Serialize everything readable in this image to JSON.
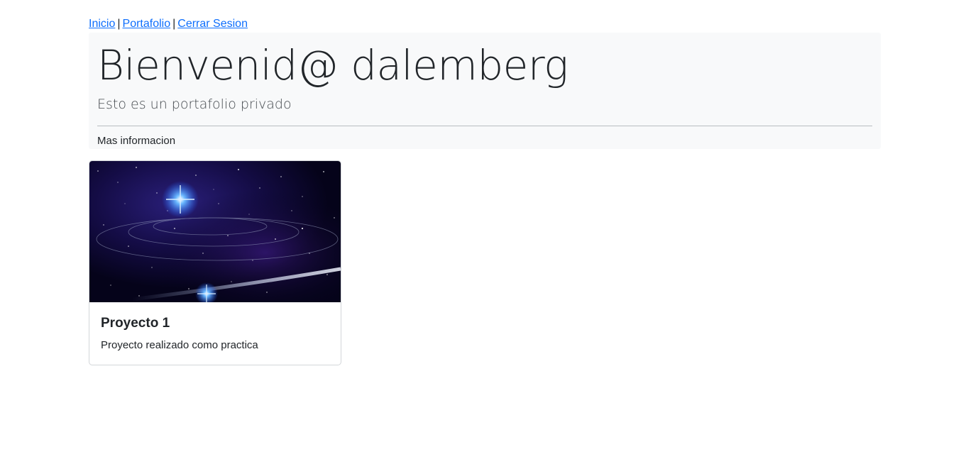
{
  "nav": {
    "links": [
      {
        "label": "Inicio"
      },
      {
        "label": "Portafolio"
      },
      {
        "label": "Cerrar Sesion"
      }
    ],
    "separator": "|"
  },
  "hero": {
    "title": "Bienvenid@ dalemberg",
    "subtitle": "Esto es un portafolio privado",
    "more_info": "Mas informacion"
  },
  "projects": [
    {
      "title": "Proyecto 1",
      "description": "Proyecto realizado como practica",
      "image": "galaxy-starfield-image"
    }
  ],
  "colors": {
    "link": "#0d6efd",
    "hero_bg": "#f8f9fa",
    "text": "#212529",
    "card_border": "#d3d6d9"
  }
}
